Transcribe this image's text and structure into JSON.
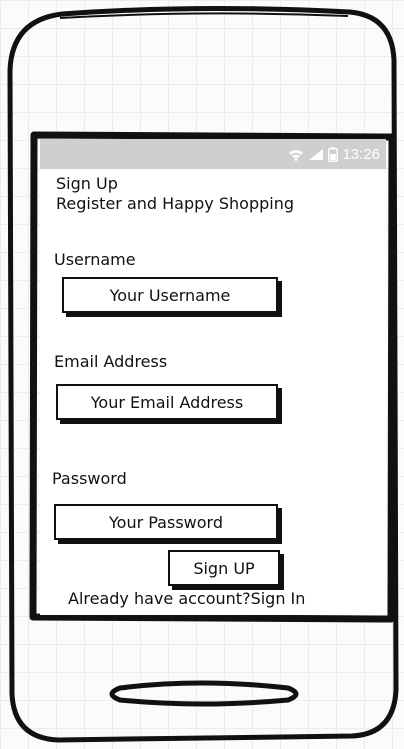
{
  "status_bar": {
    "time": "13:26",
    "icons": [
      "wifi-icon",
      "signal-icon",
      "battery-icon"
    ],
    "color": "#cfcfcf"
  },
  "header": {
    "title": "Sign Up",
    "subtitle": "Register and Happy Shopping"
  },
  "form": {
    "username_label": "Username",
    "username_placeholder": "Your Username",
    "email_label": "Email Address",
    "email_placeholder": "Your Email Address",
    "password_label": "Password",
    "password_placeholder": "Your Password",
    "submit_label": "Sign UP"
  },
  "footer": {
    "prompt": "Already have account?",
    "link": "Sign In"
  }
}
